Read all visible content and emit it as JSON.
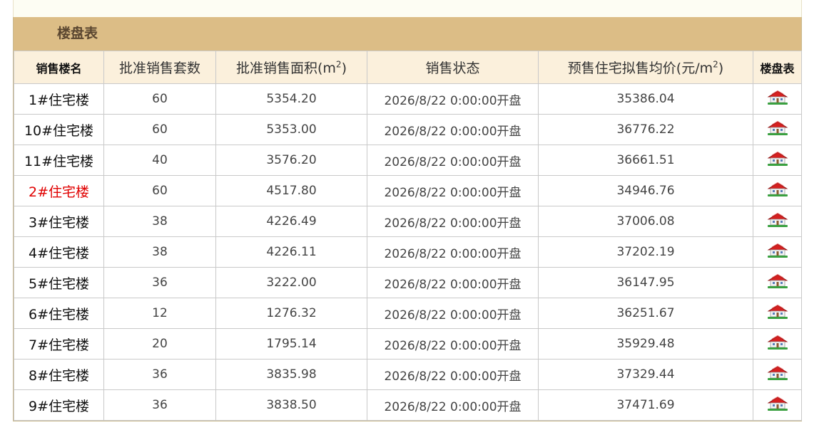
{
  "panel": {
    "title": "楼盘表"
  },
  "table": {
    "headers": {
      "name": "销售楼名",
      "units": "批准销售套数",
      "area_prefix": "批准销售面积(m",
      "area_sup": "2",
      "area_suffix": ")",
      "status": "销售状态",
      "price_prefix": "预售住宅拟售均价(元/m",
      "price_sup": "2",
      "price_suffix": ")",
      "plan": "楼盘表"
    },
    "rows": [
      {
        "name": "1#住宅楼",
        "units": "60",
        "area": "5354.20",
        "status": "2026/8/22 0:00:00开盘",
        "price": "35386.04",
        "highlight": false
      },
      {
        "name": "10#住宅楼",
        "units": "60",
        "area": "5353.00",
        "status": "2026/8/22 0:00:00开盘",
        "price": "36776.22",
        "highlight": false
      },
      {
        "name": "11#住宅楼",
        "units": "40",
        "area": "3576.20",
        "status": "2026/8/22 0:00:00开盘",
        "price": "36661.51",
        "highlight": false
      },
      {
        "name": "2#住宅楼",
        "units": "60",
        "area": "4517.80",
        "status": "2026/8/22 0:00:00开盘",
        "price": "34946.76",
        "highlight": true
      },
      {
        "name": "3#住宅楼",
        "units": "38",
        "area": "4226.49",
        "status": "2026/8/22 0:00:00开盘",
        "price": "37006.08",
        "highlight": false
      },
      {
        "name": "4#住宅楼",
        "units": "38",
        "area": "4226.11",
        "status": "2026/8/22 0:00:00开盘",
        "price": "37202.19",
        "highlight": false
      },
      {
        "name": "5#住宅楼",
        "units": "36",
        "area": "3222.00",
        "status": "2026/8/22 0:00:00开盘",
        "price": "36147.95",
        "highlight": false
      },
      {
        "name": "6#住宅楼",
        "units": "12",
        "area": "1276.32",
        "status": "2026/8/22 0:00:00开盘",
        "price": "36251.67",
        "highlight": false
      },
      {
        "name": "7#住宅楼",
        "units": "20",
        "area": "1795.14",
        "status": "2026/8/22 0:00:00开盘",
        "price": "35929.48",
        "highlight": false
      },
      {
        "name": "8#住宅楼",
        "units": "36",
        "area": "3835.98",
        "status": "2026/8/22 0:00:00开盘",
        "price": "37329.44",
        "highlight": false
      },
      {
        "name": "9#住宅楼",
        "units": "36",
        "area": "3838.50",
        "status": "2026/8/22 0:00:00开盘",
        "price": "37471.69",
        "highlight": false
      }
    ],
    "row_icon": "house-icon"
  },
  "colors": {
    "title_bar": "#dcbd86",
    "header_bg": "#fbf0dc",
    "highlight_text": "#e00000",
    "border": "#c9c9c9"
  }
}
